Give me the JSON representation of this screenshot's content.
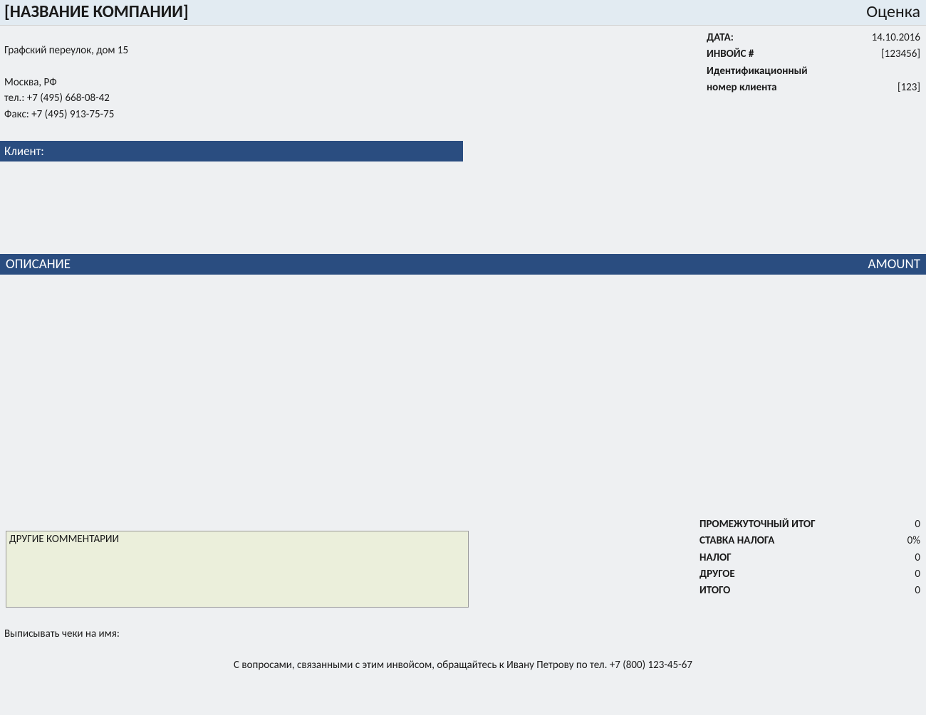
{
  "header": {
    "company_name": "[НАЗВАНИЕ КОМПАНИИ]",
    "doc_type": "Оценка"
  },
  "company": {
    "address1": "Графский переулок, дом 15",
    "city": "Москва, РФ",
    "phone": "тел.: +7 (495) 668-08-42",
    "fax": "Факс: +7 (495) 913-75-75"
  },
  "meta": {
    "date_label": "ДАТА:",
    "date_value": "14.10.2016",
    "invoice_label": "ИНВОЙС #",
    "invoice_value": "[123456]",
    "clientid_label1": "Идентификационный",
    "clientid_label2": "номер клиента",
    "clientid_value": "[123]"
  },
  "client_bar": "Клиент:",
  "table": {
    "col_desc": "ОПИСАНИЕ",
    "col_amount": "AMOUNT"
  },
  "comments": {
    "title": "ДРУГИЕ КОММЕНТАРИИ"
  },
  "totals": {
    "subtotal_label": "ПРОМЕЖУТОЧНЫЙ ИТОГ",
    "subtotal_value": "0",
    "taxrate_label": "СТАВКА НАЛОГА",
    "taxrate_value": "0%",
    "tax_label": "НАЛОГ",
    "tax_value": "0",
    "other_label": "ДРУГОЕ",
    "other_value": "0",
    "total_label": "ИТОГО",
    "total_value": "0"
  },
  "checks_line": "Выписывать чеки на имя:",
  "footer": "С вопросами, связанными с этим инвойсом, обращайтесь к Ивану Петрову по тел. +7 (800) 123-45-67"
}
